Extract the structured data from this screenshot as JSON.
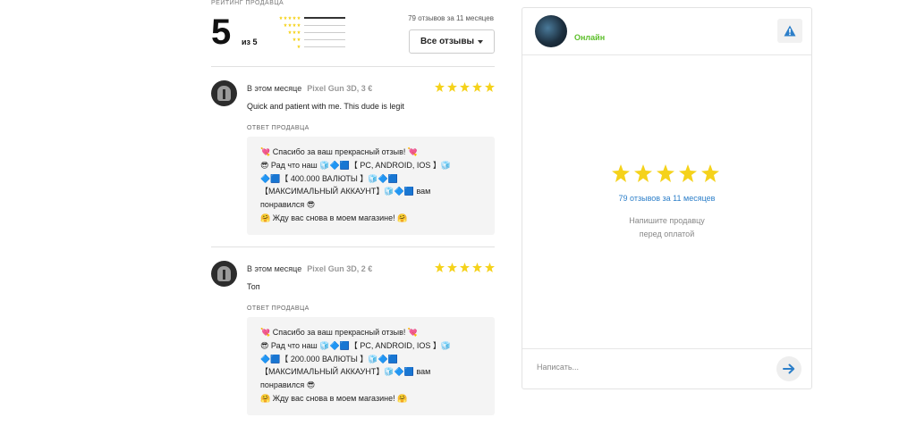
{
  "rating": {
    "caption": "РЕЙТИНГ ПРОДАВЦА",
    "score": "5",
    "of": "из 5",
    "summary": "79 отзывов за 11 месяцев",
    "all_reviews_label": "Все отзывы",
    "distribution": [
      {
        "stars": 5,
        "fraction": 1.0
      },
      {
        "stars": 4,
        "fraction": 0
      },
      {
        "stars": 3,
        "fraction": 0
      },
      {
        "stars": 2,
        "fraction": 0
      },
      {
        "stars": 1,
        "fraction": 0
      }
    ]
  },
  "reviews": [
    {
      "date": "В этом месяце",
      "product": "Pixel Gun 3D, 3 €",
      "stars": 5,
      "text": "Quick and patient with me. This dude is legit",
      "reply_caption": "ОТВЕТ ПРОДАВЦА",
      "reply_lines": [
        "💘 Спасибо за ваш прекрасный отзыв! 💘",
        "😎 Рад что наш 🧊🔷🟦【 PC, ANDROID, IOS 】🧊",
        "🔷🟦【 400.000 ВАЛЮТЫ 】🧊🔷🟦",
        "【МАКСИМАЛЬНЫЙ АККАУНТ】🧊🔷🟦 вам",
        "понравился 😎",
        "🤗 Жду вас снова в моем магазине! 🤗"
      ]
    },
    {
      "date": "В этом месяце",
      "product": "Pixel Gun 3D, 2 €",
      "stars": 5,
      "text": "Топ",
      "reply_caption": "ОТВЕТ ПРОДАВЦА",
      "reply_lines": [
        "💘 Спасибо за ваш прекрасный отзыв! 💘",
        "😎 Рад что наш 🧊🔷🟦【 PC, ANDROID, IOS 】🧊",
        "🔷🟦【 200.000 ВАЛЮТЫ 】🧊🔷🟦",
        "【МАКСИМАЛЬНЫЙ АККАУНТ】🧊🔷🟦 вам",
        "понравился 😎",
        "🤗 Жду вас снова в моем магазине! 🤗"
      ]
    }
  ],
  "chat": {
    "status": "Онлайн",
    "stars": 5,
    "reviews_link": "79 отзывов за 11 месяцев",
    "hint_line1": "Напишите продавцу",
    "hint_line2": "перед оплатой",
    "input_placeholder": "Написать..."
  },
  "colors": {
    "star": "#f5d21b",
    "online": "#5cbf2a",
    "link": "#2d7fc9",
    "warning_icon": "#2d7fc9",
    "send_icon": "#2d7fc9"
  },
  "icons": {
    "warning": "warning-triangle-icon",
    "send": "arrow-right-icon",
    "dropdown": "chevron-down-icon"
  }
}
